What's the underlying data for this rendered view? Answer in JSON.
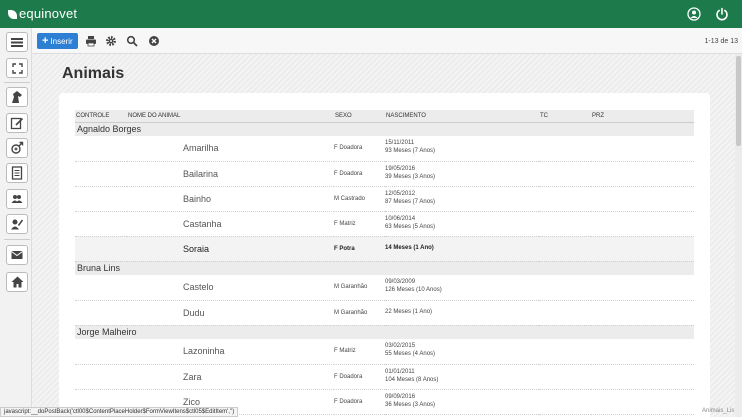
{
  "header": {
    "logo_text": "equinovet"
  },
  "toolbar": {
    "insert_label": "Inserir",
    "pager": "1-13 de 13"
  },
  "page": {
    "title": "Animais"
  },
  "table": {
    "columns": [
      "CONTROLE",
      "NOME DO ANIMAL",
      "SEXO",
      "NASCIMENTO",
      "TC",
      "PRZ"
    ],
    "groups": [
      {
        "owner": "Agnaldo Borges",
        "rows": [
          {
            "name": "Amarilha",
            "sexo": "F Doadora",
            "date": "15/11/2011",
            "age": "93 Meses (7 Anos)"
          },
          {
            "name": "Bailarina",
            "sexo": "F Doadora",
            "date": "19/05/2016",
            "age": "39 Meses (3 Anos)"
          },
          {
            "name": "Bainho",
            "sexo": "M Castrado",
            "date": "12/05/2012",
            "age": "87 Meses (7 Anos)"
          },
          {
            "name": "Castanha",
            "sexo": "F Matriz",
            "date": "10/06/2014",
            "age": "63 Meses (5 Anos)"
          },
          {
            "name": "Soraia",
            "sexo": "F Potra",
            "date": "",
            "age": "14 Meses (1 Ano)"
          }
        ]
      },
      {
        "owner": "Bruna Lins",
        "rows": [
          {
            "name": "Castelo",
            "sexo": "M Garanhão",
            "date": "09/03/2009",
            "age": "126 Meses (10 Anos)"
          },
          {
            "name": "Dudu",
            "sexo": "M Garanhão",
            "date": "",
            "age": "22 Meses (1 Ano)"
          }
        ]
      },
      {
        "owner": "Jorge Malheiro",
        "rows": [
          {
            "name": "Lazoninha",
            "sexo": "F Matriz",
            "date": "03/02/2015",
            "age": "55 Meses (4 Anos)"
          },
          {
            "name": "Zara",
            "sexo": "F Doadora",
            "date": "01/01/2011",
            "age": "104 Meses (8 Anos)"
          },
          {
            "name": "Zico",
            "sexo": "F Doadora",
            "date": "09/09/2016",
            "age": "36 Meses (3 Anos)"
          }
        ]
      }
    ]
  },
  "status": {
    "left": "javascript:__doPostBack('ctl00$ContentPlaceHolder$FormViewItens$ctl05$EditItem','')",
    "right": "Animais_Lis"
  }
}
